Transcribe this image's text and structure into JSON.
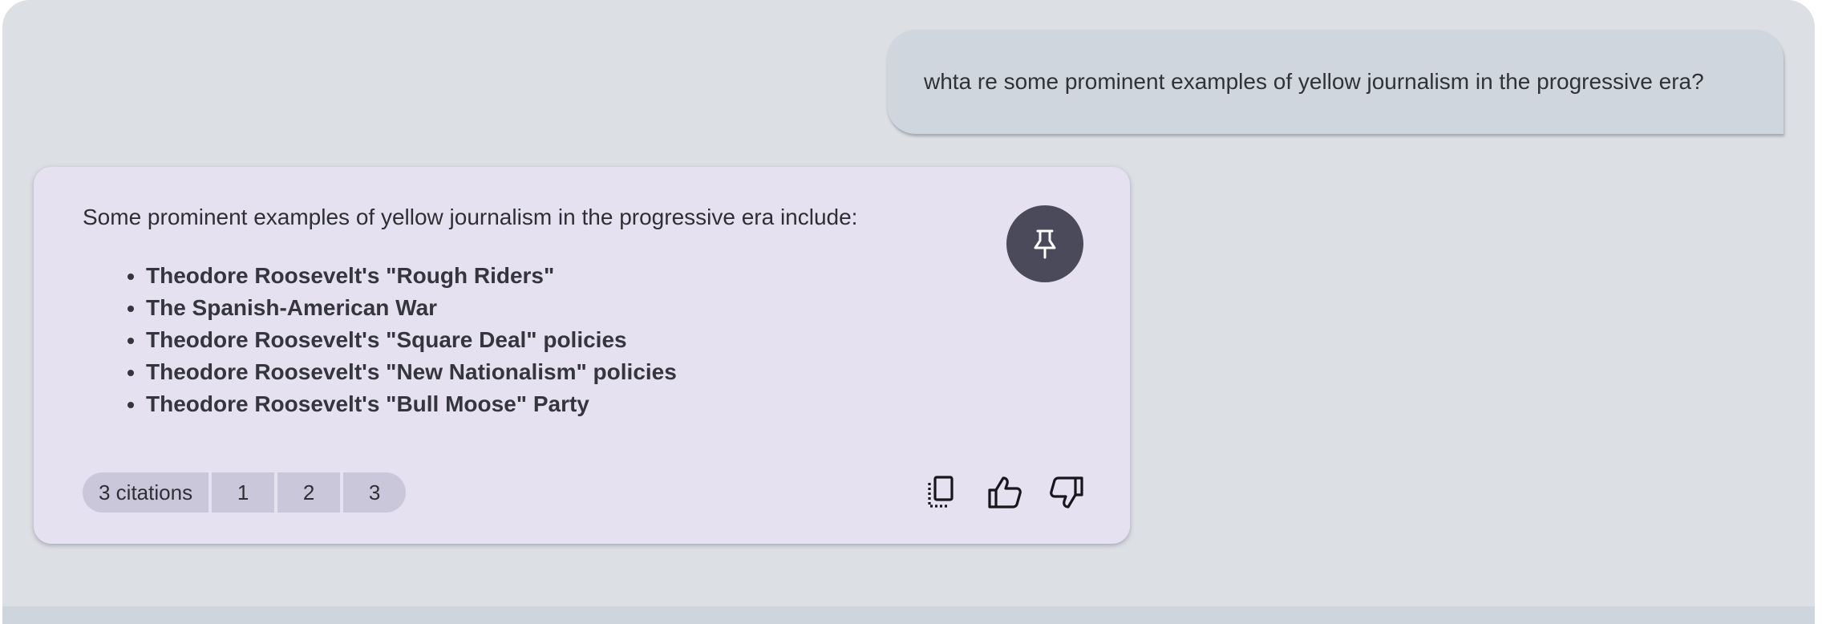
{
  "conversation": {
    "user_message": "whta re some prominent examples of yellow journalism in the progressive era?",
    "answer": {
      "intro": "Some prominent examples of yellow journalism in the progressive era include:",
      "bullets": [
        "Theodore Roosevelt's \"Rough Riders\"",
        "The Spanish-American War",
        "Theodore Roosevelt's \"Square Deal\" policies",
        "Theodore Roosevelt's \"New Nationalism\" policies",
        "Theodore Roosevelt's \"Bull Moose\" Party"
      ],
      "citations": {
        "count_label": "3 citations",
        "items": [
          "1",
          "2",
          "3"
        ]
      },
      "actions": {
        "pin_icon": "pin-icon",
        "copy_icon": "copy-icon",
        "thumbs_up_icon": "thumbs-up-icon",
        "thumbs_down_icon": "thumbs-down-icon"
      }
    }
  },
  "colors": {
    "background": "#dcdfe3",
    "user_bubble": "#cfd6de",
    "answer_card": "#e5e1f1",
    "pin_button": "#4b4a5a",
    "citation_chip": "#cbc7da"
  }
}
